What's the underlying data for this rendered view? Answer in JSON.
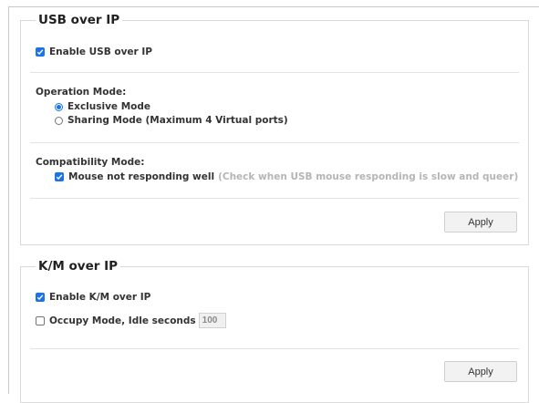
{
  "colors": {
    "accent": "#1a73e8",
    "hint_text": "#b5b5b5",
    "button_bg": "#f2f2f2"
  },
  "usb_over_ip": {
    "title": "USB over IP",
    "enable": {
      "label": "Enable USB over IP",
      "checked": true
    },
    "operation_mode": {
      "label": "Operation Mode:",
      "options": [
        {
          "label": "Exclusive Mode",
          "selected": true
        },
        {
          "label": "Sharing Mode (Maximum 4 Virtual ports)",
          "selected": false
        }
      ]
    },
    "compatibility_mode": {
      "label": "Compatibility Mode:",
      "mouse_option": {
        "label": "Mouse not responding well",
        "hint": "(Check when USB mouse responding is slow and queer)",
        "checked": true
      }
    },
    "apply_label": "Apply"
  },
  "km_over_ip": {
    "title": "K/M over IP",
    "enable": {
      "label": "Enable K/M over IP",
      "checked": true
    },
    "occupy": {
      "label": "Occupy Mode, Idle seconds",
      "checked": false,
      "idle_value": "100"
    },
    "apply_label": "Apply"
  }
}
